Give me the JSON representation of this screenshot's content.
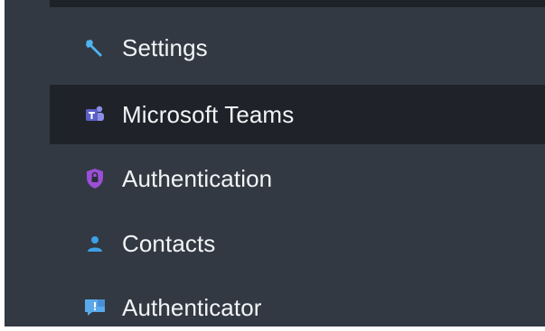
{
  "menu": {
    "items": [
      {
        "label": "Settings",
        "icon": "wrench-icon",
        "active": false
      },
      {
        "label": "Microsoft Teams",
        "icon": "teams-icon",
        "active": true
      },
      {
        "label": "Authentication",
        "icon": "shield-lock-icon",
        "active": false
      },
      {
        "label": "Contacts",
        "icon": "person-icon",
        "active": false
      },
      {
        "label": "Authenticator",
        "icon": "chat-alert-icon",
        "active": false
      }
    ]
  },
  "colors": {
    "panel_bg": "#323943",
    "active_bg": "#1f2329",
    "text": "#f2f4f6",
    "wrench": "#4fb3f0",
    "teams": "#6d6fd8",
    "shield": "#9b4fd6",
    "person": "#3ea0e6",
    "chat": "#5aa9ea"
  }
}
